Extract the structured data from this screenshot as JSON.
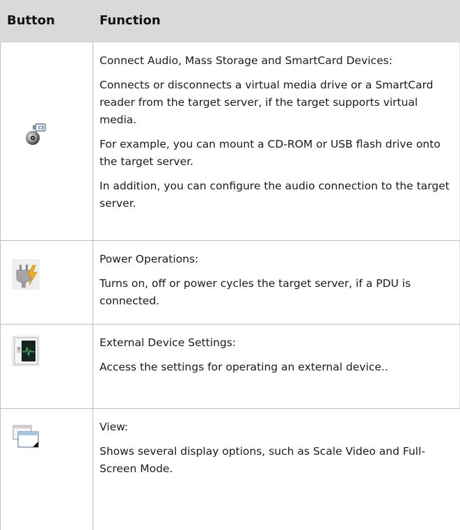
{
  "table": {
    "headers": {
      "button": "Button",
      "function": "Function"
    },
    "rows": [
      {
        "icon": "virtual-media-icon",
        "paragraphs": [
          "Connect Audio, Mass Storage and SmartCard Devices:",
          "Connects or disconnects a virtual media drive or a SmartCard reader from the target server, if the target supports virtual media.",
          "For example, you can mount a CD-ROM or USB flash drive onto the target server.",
          "In addition, you can configure the audio connection to the target server."
        ]
      },
      {
        "icon": "power-plug-icon",
        "paragraphs": [
          "Power Operations:",
          "Turns on, off or power cycles the target server, if a PDU is connected."
        ]
      },
      {
        "icon": "external-device-icon",
        "paragraphs": [
          "External Device Settings:",
          "Access the settings for operating an external device.."
        ]
      },
      {
        "icon": "view-windows-icon",
        "paragraphs": [
          "View:",
          "Shows several display options, such as Scale Video and Full-Screen Mode."
        ]
      }
    ]
  },
  "colors": {
    "header_background": "#d9d9d9",
    "border": "#bfbfbf",
    "power_accent": "#f2b21b",
    "external_screen": "#16251f",
    "external_trace": "#3fbf6a"
  }
}
